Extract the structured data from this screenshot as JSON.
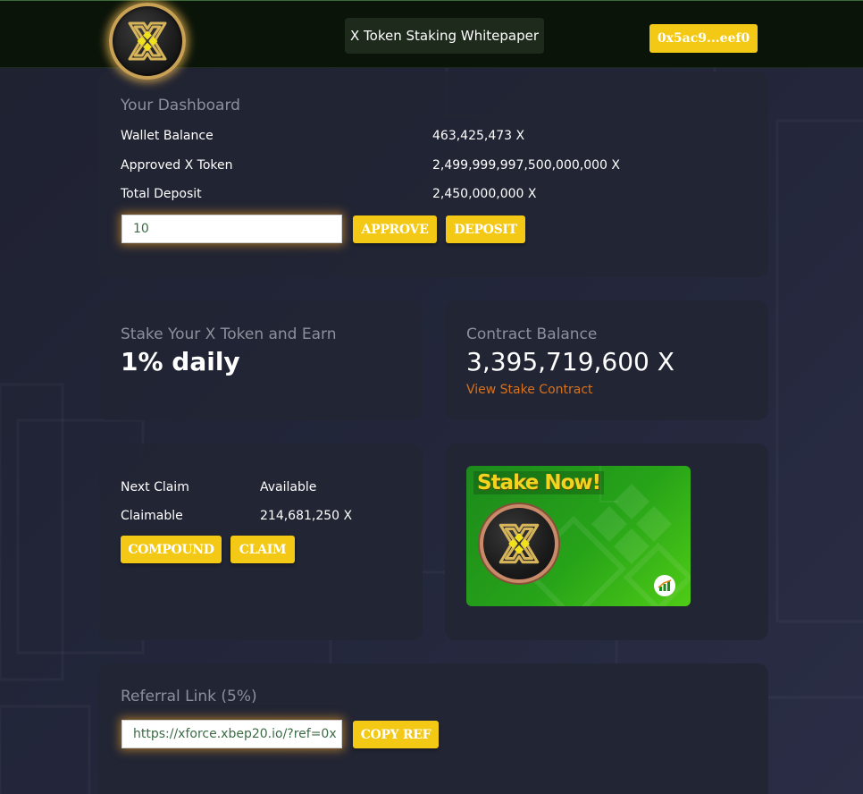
{
  "header": {
    "whitepaper_label": "X Token Staking Whitepaper",
    "wallet_address": "0x5ac9...eef0"
  },
  "dashboard": {
    "title": "Your Dashboard",
    "rows": [
      {
        "label": "Wallet Balance",
        "value": "463,425,473 X"
      },
      {
        "label": "Approved X Token",
        "value": "2,499,999,997,500,000,000 X"
      },
      {
        "label": "Total Deposit",
        "value": "2,450,000,000 X"
      }
    ],
    "amount_input": "10",
    "approve_label": "APPROVE",
    "deposit_label": "DEPOSIT"
  },
  "stake_info": {
    "title": "Stake Your X Token and Earn",
    "rate": "1% daily"
  },
  "contract": {
    "title": "Contract Balance",
    "balance": "3,395,719,600 X",
    "link": "View Stake Contract"
  },
  "claim": {
    "rows": [
      {
        "label": "Next Claim",
        "value": "Available"
      },
      {
        "label": "Claimable",
        "value": "214,681,250 X"
      }
    ],
    "compound_label": "COMPOUND",
    "claim_label": "CLAIM"
  },
  "banner": {
    "title": "Stake Now!"
  },
  "referral": {
    "title": "Referral Link (5%)",
    "link": "https://xforce.xbep20.io/?ref=0x",
    "copy_label": "COPY REF"
  },
  "colors": {
    "accent_yellow": "#f3c916",
    "link_orange": "#d9711b",
    "card_bg": "#222534",
    "header_bg": "#0b1409"
  }
}
